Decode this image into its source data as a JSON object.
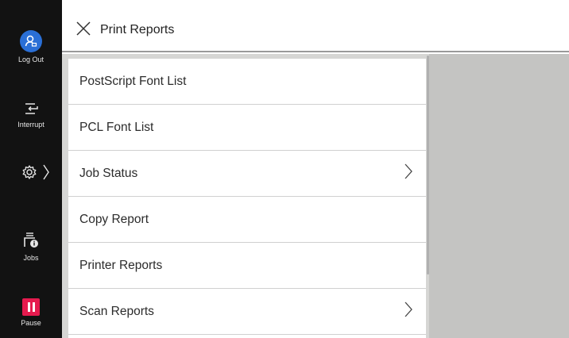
{
  "sidebar": {
    "logout_label": "Log Out",
    "interrupt_label": "Interrupt",
    "jobs_label": "Jobs",
    "pause_label": "Pause"
  },
  "header": {
    "title": "Print Reports"
  },
  "list": {
    "items": [
      {
        "label": "PostScript Font List",
        "has_arrow": false
      },
      {
        "label": "PCL Font List",
        "has_arrow": false
      },
      {
        "label": "Job Status",
        "has_arrow": true
      },
      {
        "label": "Copy Report",
        "has_arrow": false
      },
      {
        "label": "Printer Reports",
        "has_arrow": false
      },
      {
        "label": "Scan Reports",
        "has_arrow": true
      }
    ]
  },
  "colors": {
    "sidebar_bg": "#121212",
    "avatar_blue": "#2a6fd6",
    "pause_red": "#e51b4e",
    "panel_gray": "#c4c4c2"
  }
}
